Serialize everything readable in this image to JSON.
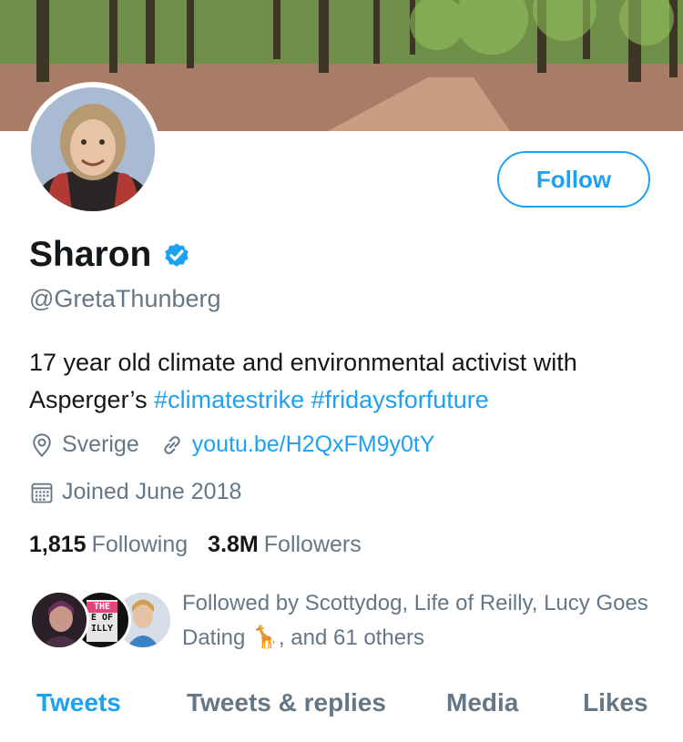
{
  "profile": {
    "name": "Sharon",
    "handle": "@GretaThunberg",
    "bio_text": "17 year old climate and environmental activist with Asperger’s",
    "hashtags": [
      "#climatestrike",
      "#fridaysforfuture"
    ],
    "location": "Sverige",
    "website": "youtu.be/H2QxFM9y0tY",
    "joined": "Joined June 2018",
    "following_count": "1,815",
    "following_label": "Following",
    "followers_count": "3.8M",
    "followers_label": "Followers",
    "followed_by": "Followed by Scottydog, Life of Reilly, Lucy Goes Dating 🦒, and 61 others",
    "mini_avatar_badge_text": [
      "THE",
      "E OF",
      "ILLY"
    ]
  },
  "actions": {
    "follow_label": "Follow"
  },
  "tabs": [
    {
      "label": "Tweets",
      "active": true
    },
    {
      "label": "Tweets & replies",
      "active": false
    },
    {
      "label": "Media",
      "active": false
    },
    {
      "label": "Likes",
      "active": false
    }
  ],
  "icons": {
    "verified": "verified-badge-icon",
    "location": "location-pin-icon",
    "link": "link-icon",
    "calendar": "calendar-icon"
  },
  "colors": {
    "accent": "#1da1f2",
    "secondary_text": "#657786",
    "primary_text": "#14171a"
  }
}
